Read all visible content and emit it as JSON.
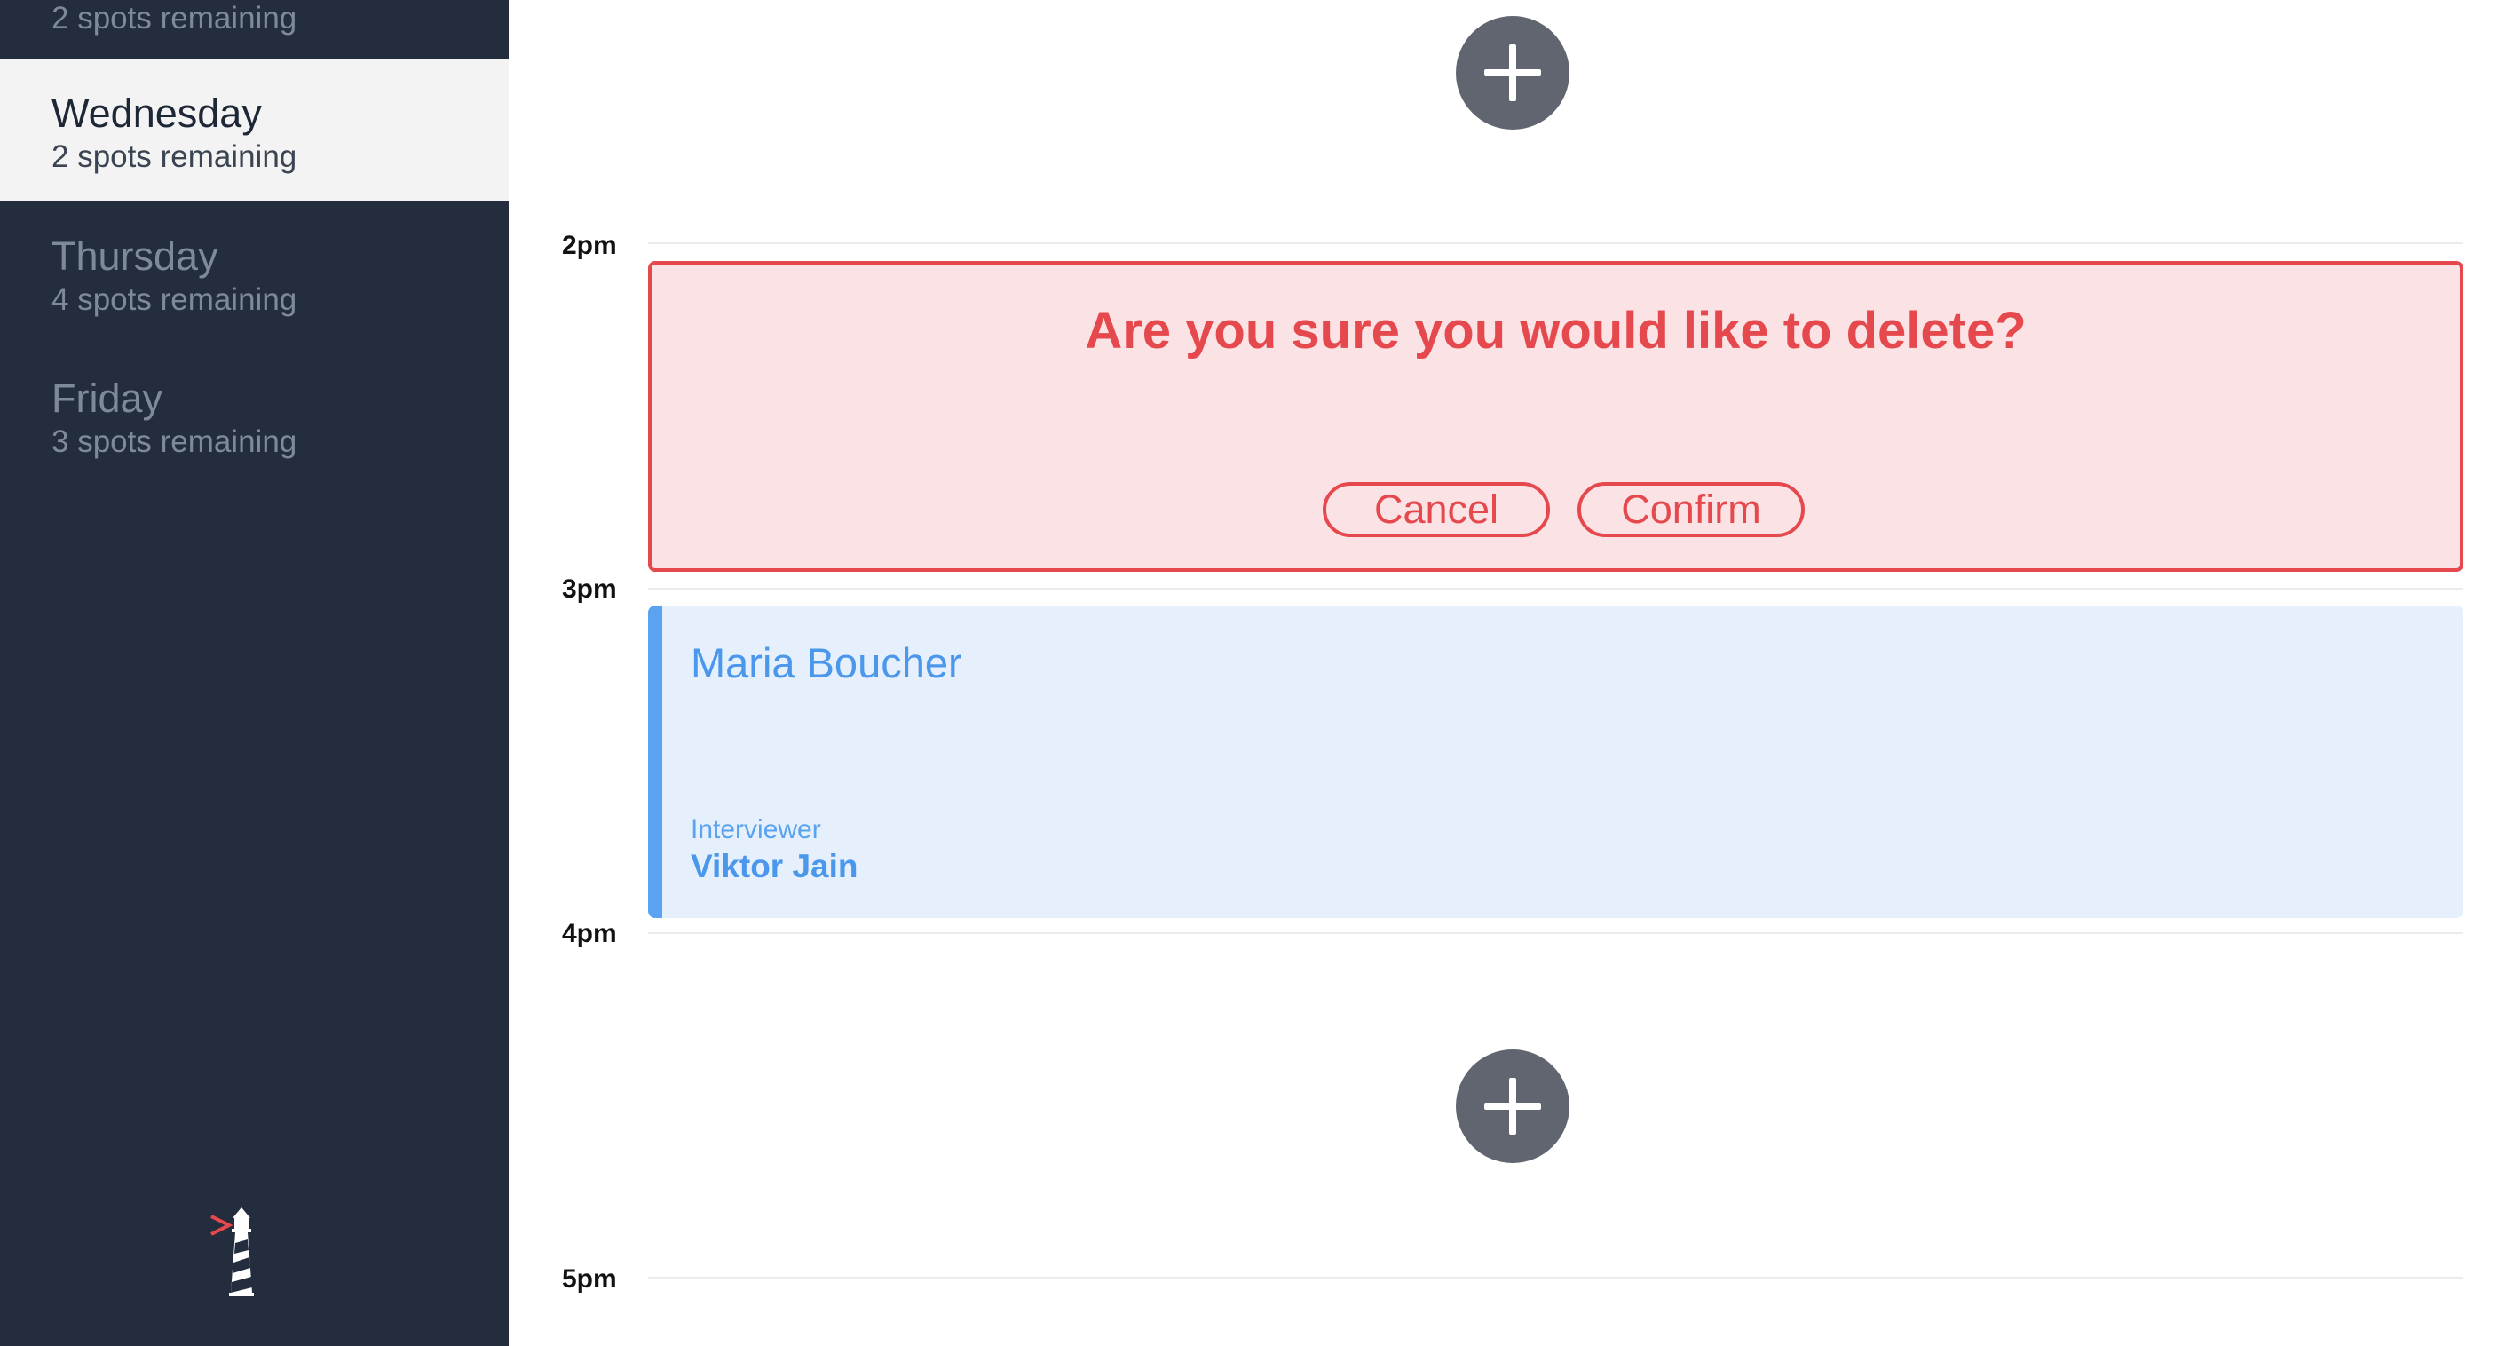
{
  "sidebar": {
    "days": [
      {
        "name": "",
        "spots": "2 spots remaining"
      },
      {
        "name": "Wednesday",
        "spots": "2 spots remaining"
      },
      {
        "name": "Thursday",
        "spots": "4 spots remaining"
      },
      {
        "name": "Friday",
        "spots": "3 spots remaining"
      }
    ],
    "active_day": "Wednesday",
    "logo_icon": "lighthouse-icon"
  },
  "schedule": {
    "hours": [
      "2pm",
      "3pm",
      "4pm",
      "5pm"
    ],
    "add_icon": "plus-icon"
  },
  "delete_confirm": {
    "question": "Are you sure you would like to delete?",
    "cancel_label": "Cancel",
    "confirm_label": "Confirm"
  },
  "interview": {
    "candidate": "Maria Boucher",
    "interviewer_caption": "Interviewer",
    "interviewer": "Viktor Jain"
  },
  "colors": {
    "sidebar_bg": "#232d3d",
    "danger": "#e5484d",
    "danger_bg": "#fbe3e5",
    "event_accent": "#5aa3f0",
    "event_bg": "#e5f0fc",
    "add_button": "#60656f"
  }
}
